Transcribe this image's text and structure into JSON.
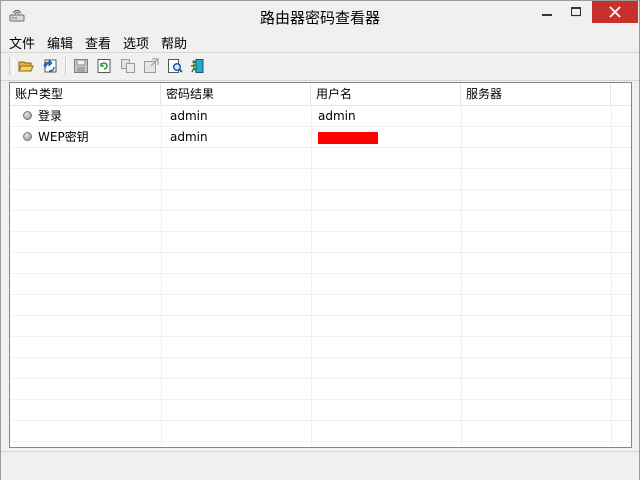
{
  "window": {
    "title": "路由器密码查看器",
    "close_color": "#c7302c"
  },
  "menu": {
    "items": [
      "文件",
      "编辑",
      "查看",
      "选项",
      "帮助"
    ]
  },
  "toolbar": {
    "icons": [
      "open-folder-icon",
      "refresh-list-icon",
      "save-icon",
      "reload-icon",
      "copy-icon",
      "properties-icon",
      "search-icon",
      "exit-icon"
    ]
  },
  "table": {
    "columns": [
      "账户类型",
      "密码结果",
      "用户名",
      "服务器"
    ],
    "rows": [
      {
        "type": "登录",
        "password": "admin",
        "username": "admin",
        "server": ""
      },
      {
        "type": "WEP密钥",
        "password": "admin",
        "username": "",
        "server": "",
        "username_redacted_color": "#ff0000"
      }
    ]
  },
  "status": {
    "text": ""
  }
}
